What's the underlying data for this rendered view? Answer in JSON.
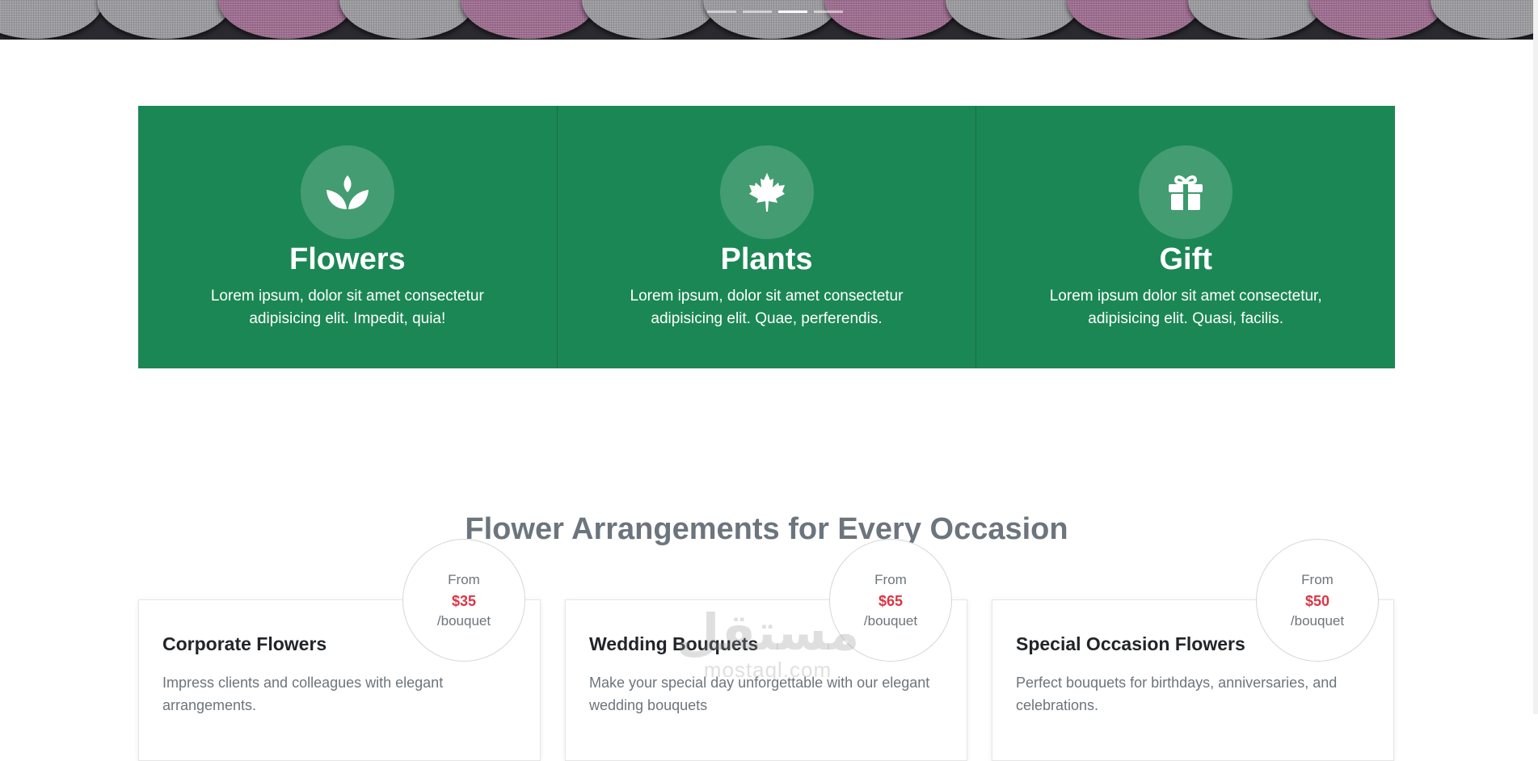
{
  "hero": {
    "slides": 4,
    "active_slide": 3
  },
  "features": [
    {
      "icon": "lotus-icon",
      "title": "Flowers",
      "text": "Lorem ipsum, dolor sit amet consectetur adipisicing elit. Impedit, quia!"
    },
    {
      "icon": "maple-leaf-icon",
      "title": "Plants",
      "text": "Lorem ipsum, dolor sit amet consectetur adipisicing elit. Quae, perferendis."
    },
    {
      "icon": "gift-icon",
      "title": "Gift",
      "text": "Lorem ipsum dolor sit amet consectetur, adipisicing elit. Quasi, facilis."
    }
  ],
  "colors": {
    "feature_bg": "#1b8754",
    "price": "#dc3545",
    "muted": "#6c757d"
  },
  "arrangements": {
    "title": "Flower Arrangements for Every Occasion",
    "cards": [
      {
        "from": "From",
        "price": "$35",
        "unit": "/bouquet",
        "title": "Corporate Flowers",
        "text": "Impress clients and colleagues with elegant arrangements."
      },
      {
        "from": "From",
        "price": "$65",
        "unit": "/bouquet",
        "title": "Wedding Bouquets",
        "text": "Make your special day unforgettable with our elegant wedding bouquets"
      },
      {
        "from": "From",
        "price": "$50",
        "unit": "/bouquet",
        "title": "Special Occasion Flowers",
        "text": "Perfect bouquets for birthdays, anniversaries, and celebrations."
      }
    ]
  },
  "watermark": {
    "logo": "مستقل",
    "site": "mostaql.com"
  }
}
